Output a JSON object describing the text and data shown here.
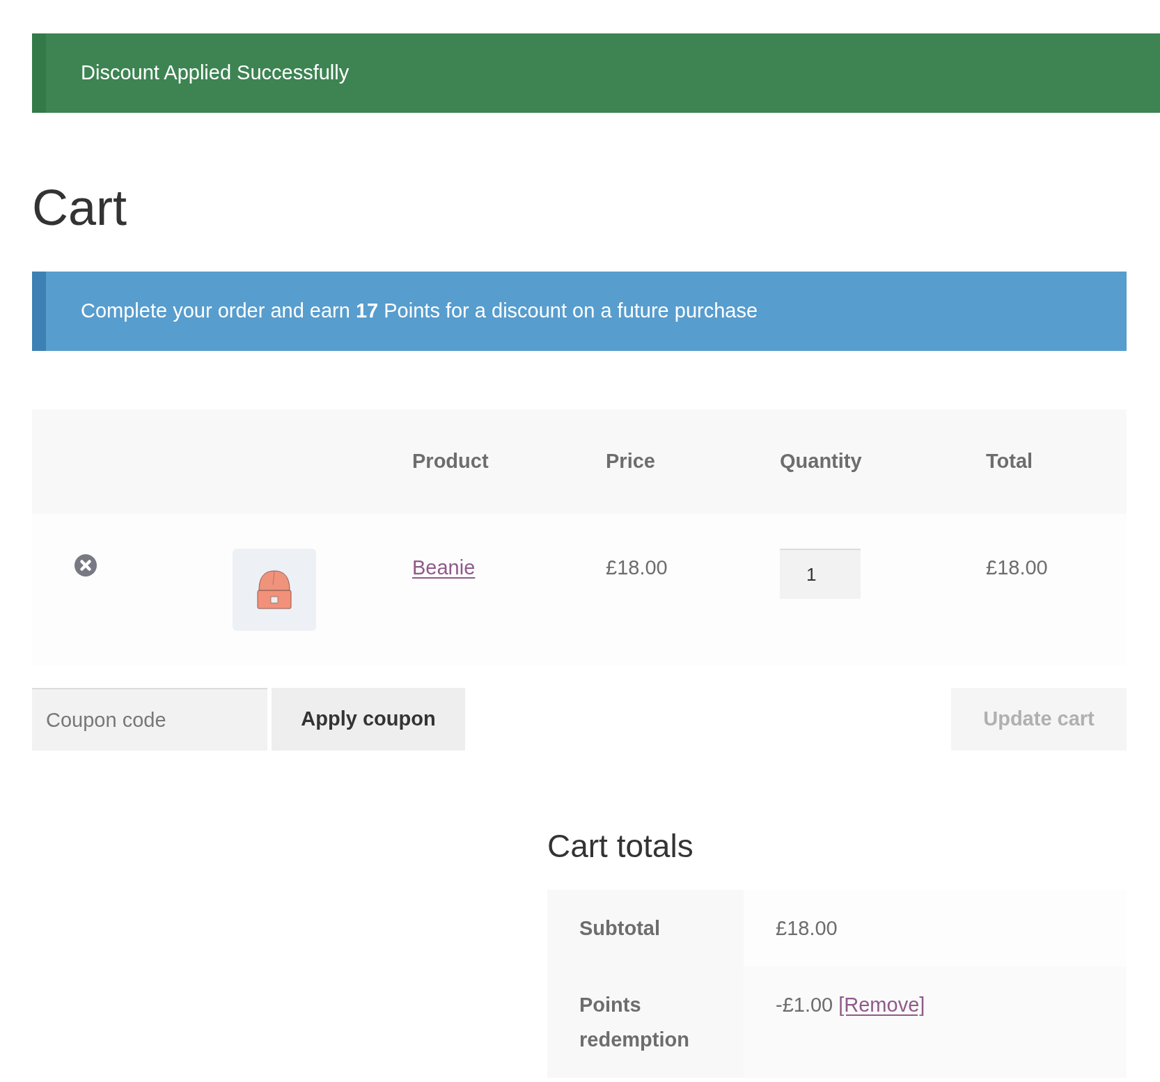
{
  "notices": [
    {
      "kind": "success",
      "text": "Discount Applied Successfully"
    },
    {
      "kind": "info",
      "text": "Complete your order and earn **17** Points for a discount on a future purchase"
    }
  ],
  "page_title": "Cart",
  "cart_table": {
    "columns": [
      "Product",
      "Price",
      "Quantity",
      "Total"
    ],
    "rows": [
      {
        "product": "Beanie",
        "price": "£18.00",
        "quantity": "1",
        "total": "£18.00"
      }
    ]
  },
  "coupon": {
    "placeholder": "Coupon code",
    "apply_button": "Apply coupon"
  },
  "update_cart": {
    "label": "Update cart",
    "disabled": true
  },
  "cart_totals": {
    "title": "Cart totals",
    "rows": [
      {
        "label": "Subtotal",
        "value": "£18.00"
      },
      {
        "label": "Points redemption",
        "value": "-£1.00",
        "link": "[Remove]"
      }
    ]
  }
}
